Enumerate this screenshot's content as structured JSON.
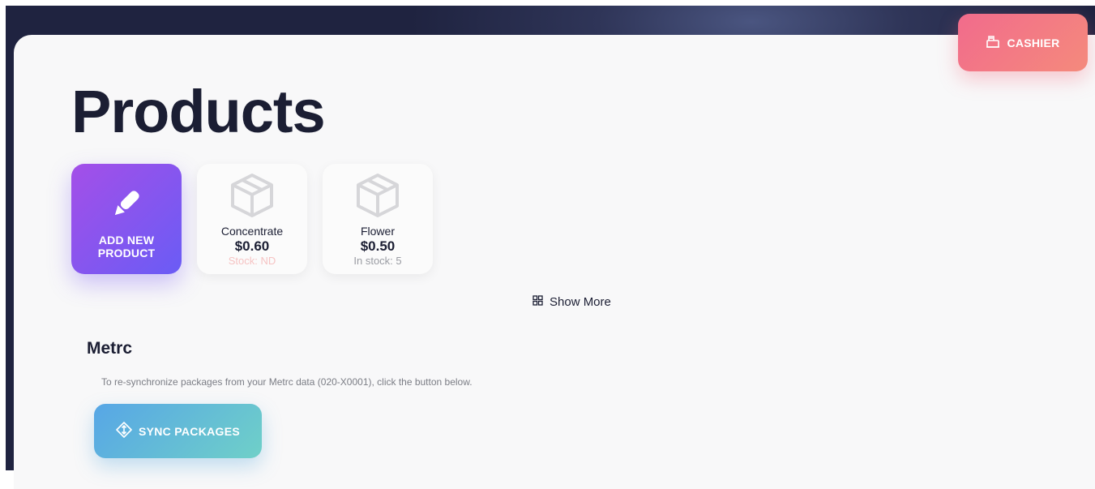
{
  "header": {
    "cashier_label": "CASHIER",
    "cashier_icon": "cash-register-icon"
  },
  "page": {
    "title": "Products"
  },
  "products": {
    "add_label": "ADD NEW PRODUCT",
    "add_icon": "pencil-icon",
    "items": [
      {
        "name": "Concentrate",
        "price": "$0.60",
        "stock": "Stock: ND",
        "stock_color": "#f6c3c3"
      },
      {
        "name": "Flower",
        "price": "$0.50",
        "stock": "In stock: 5",
        "stock_color": "#9a9ca3"
      }
    ],
    "show_more_label": "Show More",
    "show_more_icon": "grid-icon"
  },
  "metrc": {
    "title": "Metrc",
    "description": "To re-synchronize packages from your Metrc data (020-X0001), click the button below.",
    "sync_label": "SYNC PACKAGES",
    "sync_icon": "sync-diamond-icon"
  },
  "colors": {
    "dark_text": "#1b1e33",
    "cashier_gradient": [
      "#f26b8c",
      "#f48a7c"
    ],
    "add_gradient": [
      "#a44fe8",
      "#6a5cf5"
    ],
    "sync_gradient": [
      "#57a6e6",
      "#6fd0c8"
    ]
  }
}
